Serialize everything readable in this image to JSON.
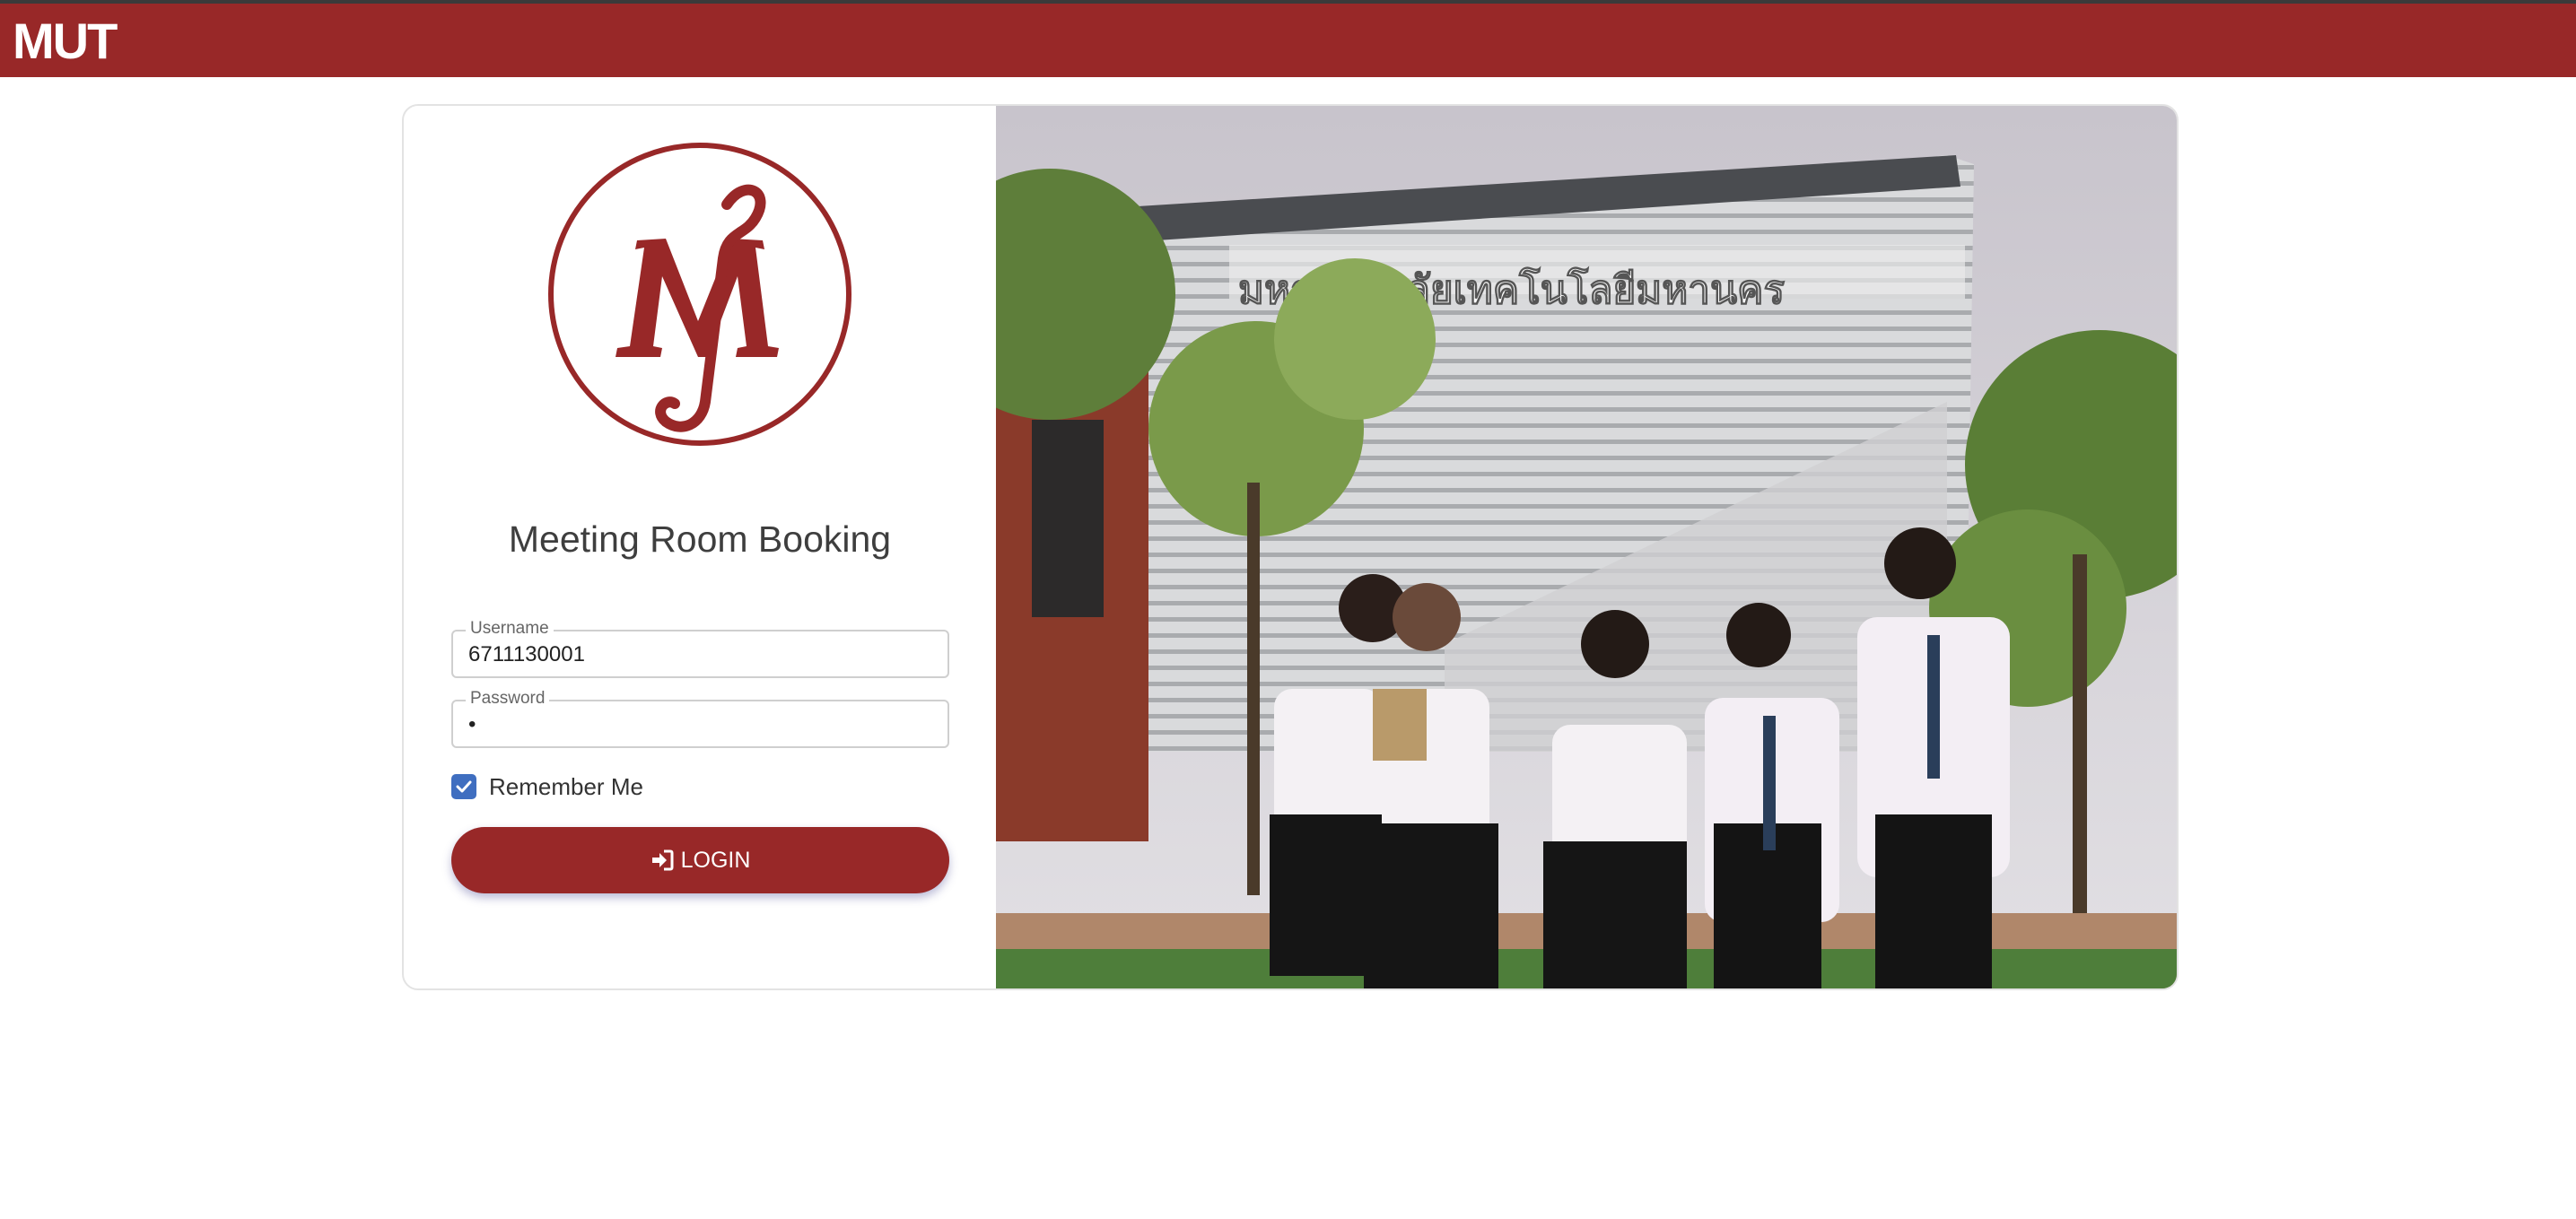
{
  "header": {
    "brand": "MUT"
  },
  "login": {
    "title": "Meeting Room Booking",
    "username_label": "Username",
    "username_value": "6711130001",
    "password_label": "Password",
    "password_value": "•",
    "remember_label": "Remember Me",
    "remember_checked": true,
    "login_label": "LOGIN",
    "login_icon": "sign-in-icon"
  },
  "hero": {
    "building_sign": "มหาวิทยาลัยเทคโนโลยีมหานคร"
  },
  "colors": {
    "brand": "#982828",
    "checkbox": "#3f6ec0"
  }
}
